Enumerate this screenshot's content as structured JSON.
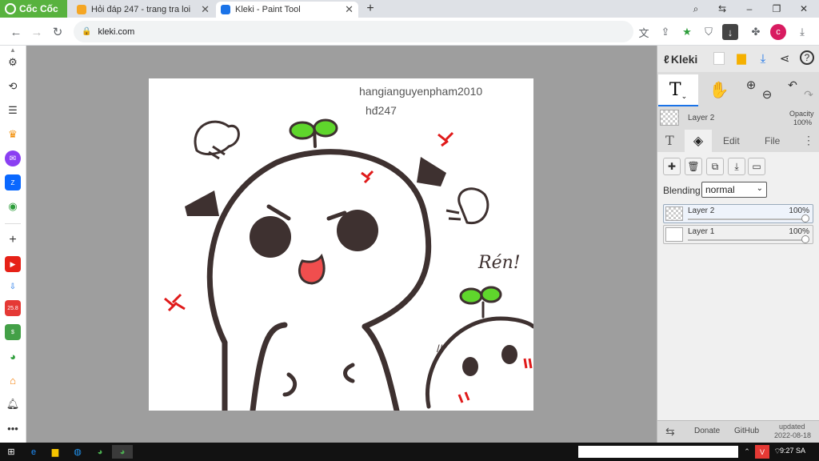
{
  "browser": {
    "brand": "Cốc Cốc",
    "tabs": [
      {
        "title": "Hỏi đáp 247 - trang tra loi",
        "active": false
      },
      {
        "title": "Kleki - Paint Tool",
        "active": true
      }
    ],
    "new_tab": "+",
    "url": "kleki.com",
    "profile_initial": "c"
  },
  "canvas": {
    "watermark_user": "hangianguyenpham2010",
    "watermark_site": "hđ247",
    "drawing_text": "Rén!",
    "small_marks": "//",
    "colors": {
      "sprout": "#5fd62c",
      "outline": "#3e3130",
      "tongue": "#f04e4e",
      "anger": "#e01a1a"
    }
  },
  "kleki": {
    "logo": "Kleki",
    "current_layer": "Layer 2",
    "opacity_label": "Opacity",
    "opacity_value": "100%",
    "tabs": {
      "edit": "Edit",
      "file": "File"
    },
    "blending_label": "Blending",
    "blending_value": "normal",
    "layers": [
      {
        "name": "Layer 2",
        "opacity": "100%",
        "selected": true
      },
      {
        "name": "Layer 1",
        "opacity": "100%",
        "selected": false
      }
    ],
    "footer": {
      "donate": "Donate",
      "github": "GitHub",
      "updated_label": "updated",
      "updated_date": "2022-08-18"
    }
  },
  "taskbar": {
    "time": "9:27 SA"
  },
  "icons": {
    "sidebar": [
      "scroll-up-icon",
      "gear-icon",
      "history-icon",
      "notes-icon",
      "crown-icon",
      "messenger-icon",
      "zalo-icon",
      "gamepad-icon",
      "add-icon",
      "youtube-icon",
      "download-icon",
      "calendar-icon",
      "coupon-icon",
      "chrome-web-icon",
      "shopping-icon",
      "bell-icon",
      "more-icon"
    ]
  }
}
